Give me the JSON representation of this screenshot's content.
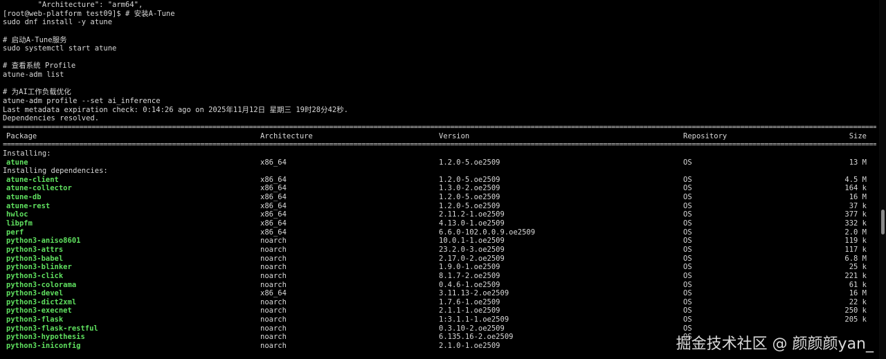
{
  "preamble": [
    "        \"Architecture\": \"arm64\",",
    "[root@web-platform test09]$ # 安装A-Tune",
    "sudo dnf install -y atune",
    "",
    "# 启动A-Tune服务",
    "sudo systemctl start atune",
    "",
    "# 查看系统 Profile",
    "atune-adm list",
    "",
    "# 为AI工作负载优化",
    "atune-adm profile --set ai_inference",
    "Last metadata expiration check: 0:14:26 ago on 2025年11月12日 星期三 19时28分42秒.",
    "Dependencies resolved."
  ],
  "separator": "================================================================================================================================================================================================================================",
  "table": {
    "headers": {
      "package": "Package",
      "architecture": "Architecture",
      "version": "Version",
      "repository": "Repository",
      "size": "Size"
    },
    "installing_label": "Installing:",
    "installing": [
      {
        "package": "atune",
        "arch": "x86_64",
        "version": "1.2.0-5.oe2509",
        "repo": "OS",
        "size": "13 M"
      }
    ],
    "dependencies_label": "Installing dependencies:",
    "dependencies": [
      {
        "package": "atune-client",
        "arch": "x86_64",
        "version": "1.2.0-5.oe2509",
        "repo": "OS",
        "size": "4.5 M"
      },
      {
        "package": "atune-collector",
        "arch": "x86_64",
        "version": "1.3.0-2.oe2509",
        "repo": "OS",
        "size": "164 k"
      },
      {
        "package": "atune-db",
        "arch": "x86_64",
        "version": "1.2.0-5.oe2509",
        "repo": "OS",
        "size": "16 M"
      },
      {
        "package": "atune-rest",
        "arch": "x86_64",
        "version": "1.2.0-5.oe2509",
        "repo": "OS",
        "size": "37 k"
      },
      {
        "package": "hwloc",
        "arch": "x86_64",
        "version": "2.11.2-1.oe2509",
        "repo": "OS",
        "size": "377 k"
      },
      {
        "package": "libpfm",
        "arch": "x86_64",
        "version": "4.13.0-1.oe2509",
        "repo": "OS",
        "size": "332 k"
      },
      {
        "package": "perf",
        "arch": "x86_64",
        "version": "6.6.0-102.0.0.9.oe2509",
        "repo": "OS",
        "size": "2.0 M"
      },
      {
        "package": "python3-aniso8601",
        "arch": "noarch",
        "version": "10.0.1-1.oe2509",
        "repo": "OS",
        "size": "119 k"
      },
      {
        "package": "python3-attrs",
        "arch": "noarch",
        "version": "23.2.0-3.oe2509",
        "repo": "OS",
        "size": "117 k"
      },
      {
        "package": "python3-babel",
        "arch": "noarch",
        "version": "2.17.0-2.oe2509",
        "repo": "OS",
        "size": "6.8 M"
      },
      {
        "package": "python3-blinker",
        "arch": "noarch",
        "version": "1.9.0-1.oe2509",
        "repo": "OS",
        "size": "25 k"
      },
      {
        "package": "python3-click",
        "arch": "noarch",
        "version": "8.1.7-2.oe2509",
        "repo": "OS",
        "size": "221 k"
      },
      {
        "package": "python3-colorama",
        "arch": "noarch",
        "version": "0.4.6-1.oe2509",
        "repo": "OS",
        "size": "61 k"
      },
      {
        "package": "python3-devel",
        "arch": "x86_64",
        "version": "3.11.13-2.oe2509",
        "repo": "OS",
        "size": "16 M"
      },
      {
        "package": "python3-dict2xml",
        "arch": "noarch",
        "version": "1.7.6-1.oe2509",
        "repo": "OS",
        "size": "22 k"
      },
      {
        "package": "python3-execnet",
        "arch": "noarch",
        "version": "2.1.1-1.oe2509",
        "repo": "OS",
        "size": "250 k"
      },
      {
        "package": "python3-flask",
        "arch": "noarch",
        "version": "1:3.1.1-1.oe2509",
        "repo": "OS",
        "size": "205 k"
      },
      {
        "package": "python3-flask-restful",
        "arch": "noarch",
        "version": "0.3.10-2.oe2509",
        "repo": "OS",
        "size": ""
      },
      {
        "package": "python3-hypothesis",
        "arch": "noarch",
        "version": "6.135.16-2.oe2509",
        "repo": "OS",
        "size": ""
      },
      {
        "package": "python3-iniconfig",
        "arch": "noarch",
        "version": "2.1.0-1.oe2509",
        "repo": "",
        "size": ""
      }
    ]
  },
  "watermark": "掘金技术社区 @ 颜颜颜yan_",
  "colors": {
    "background": "#000000",
    "text": "#d8d8d8",
    "package_name": "#5fe05f"
  }
}
